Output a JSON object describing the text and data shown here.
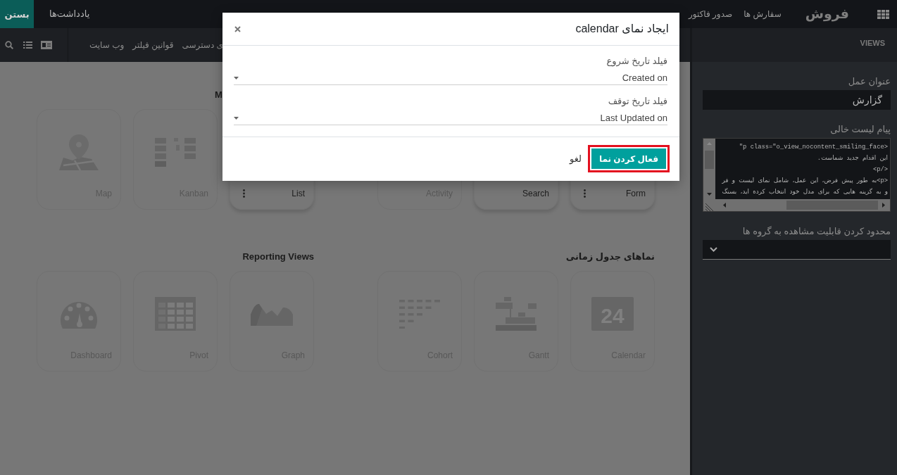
{
  "top_bar": {
    "app_name": "فروش",
    "menu_items": [
      "سفارش ها",
      "صدور فاکتور"
    ],
    "notes_link": "یادداشت‌ها",
    "close_button": "بستن"
  },
  "studio_bar": {
    "tabs": [
      "ی دسترسی",
      "قوانین فیلتر",
      "وب سایت"
    ]
  },
  "view_groups": [
    {
      "cards": [
        {
          "label": "Form",
          "active": true,
          "menu": true
        },
        {
          "label": "Search",
          "active": true,
          "menu": false
        },
        {
          "label": "Activity",
          "active": false,
          "menu": false
        }
      ]
    },
    {
      "heading": "M",
      "cards": [
        {
          "label": "List",
          "active": true,
          "menu": true
        },
        {
          "label": "Kanban",
          "kind": "kanban",
          "active": false,
          "menu": false
        },
        {
          "label": "Map",
          "kind": "map",
          "active": false,
          "menu": false
        }
      ]
    },
    {
      "heading": "نماهای جدول زمانی",
      "cards": [
        {
          "label": "Calendar",
          "kind": "calendar",
          "icon_text": "24",
          "active": false,
          "menu": false
        },
        {
          "label": "Gantt",
          "kind": "gantt",
          "active": false,
          "menu": false
        },
        {
          "label": "Cohort",
          "kind": "cohort",
          "active": false,
          "menu": false
        }
      ]
    },
    {
      "heading": "Reporting Views",
      "cards": [
        {
          "label": "Graph",
          "kind": "graph",
          "active": false,
          "menu": false
        },
        {
          "label": "Pivot",
          "kind": "pivot",
          "active": false,
          "menu": false
        },
        {
          "label": "Dashboard",
          "kind": "dashboard",
          "active": false,
          "menu": false
        }
      ]
    }
  ],
  "sidebar": {
    "title": "VIEWS",
    "fields": [
      {
        "kind": "text",
        "label": "عنوان عمل",
        "value": "گزارش"
      },
      {
        "kind": "code",
        "label": "پیام لیست خالی",
        "lines": [
          "<p class=\"o_view_nocontent_smiling_face\"",
          "این اقدام جدید شماست.",
          "</p>",
          "<p>به طور پیش فرض، این عمل، شامل نمای لیست و فر",
          "و به گزینه هایی که برای مدل خود انتخاب کرده اید، بستگ"
        ]
      },
      {
        "kind": "select",
        "label": "محدود کردن قابلیت مشاهده به گروه ها"
      }
    ]
  },
  "dialog": {
    "title": "ایجاد نمای calendar",
    "fields": [
      {
        "label": "فیلد تاریخ شروع",
        "value": "Created on"
      },
      {
        "label": "فیلد تاریخ توقف",
        "value": "Last Updated on"
      }
    ],
    "buttons": [
      {
        "kind": "primary",
        "label": "فعال کردن نما",
        "highlighted": true
      },
      {
        "kind": "link",
        "label": "لغو",
        "highlighted": false
      }
    ]
  }
}
